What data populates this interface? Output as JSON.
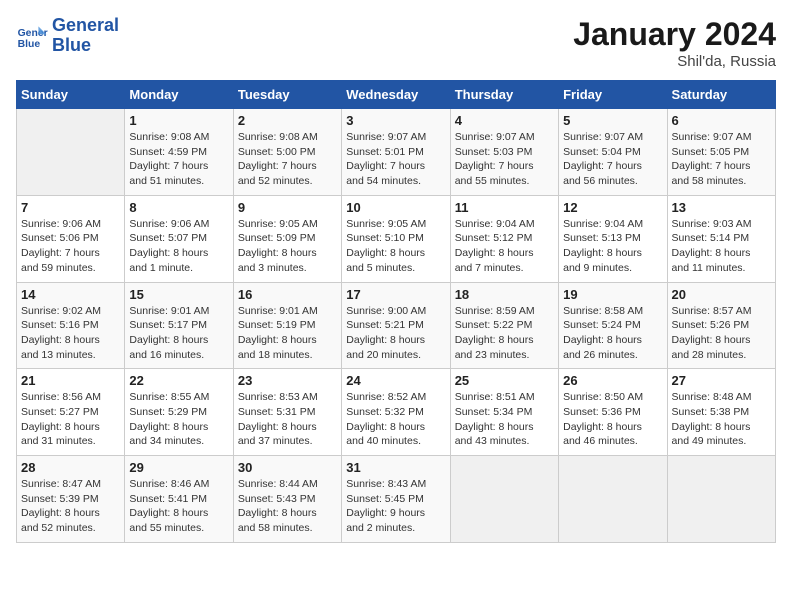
{
  "logo": {
    "line1": "General",
    "line2": "Blue"
  },
  "title": "January 2024",
  "subtitle": "Shil'da, Russia",
  "headers": [
    "Sunday",
    "Monday",
    "Tuesday",
    "Wednesday",
    "Thursday",
    "Friday",
    "Saturday"
  ],
  "weeks": [
    [
      {
        "day": "",
        "info": ""
      },
      {
        "day": "1",
        "info": "Sunrise: 9:08 AM\nSunset: 4:59 PM\nDaylight: 7 hours\nand 51 minutes."
      },
      {
        "day": "2",
        "info": "Sunrise: 9:08 AM\nSunset: 5:00 PM\nDaylight: 7 hours\nand 52 minutes."
      },
      {
        "day": "3",
        "info": "Sunrise: 9:07 AM\nSunset: 5:01 PM\nDaylight: 7 hours\nand 54 minutes."
      },
      {
        "day": "4",
        "info": "Sunrise: 9:07 AM\nSunset: 5:03 PM\nDaylight: 7 hours\nand 55 minutes."
      },
      {
        "day": "5",
        "info": "Sunrise: 9:07 AM\nSunset: 5:04 PM\nDaylight: 7 hours\nand 56 minutes."
      },
      {
        "day": "6",
        "info": "Sunrise: 9:07 AM\nSunset: 5:05 PM\nDaylight: 7 hours\nand 58 minutes."
      }
    ],
    [
      {
        "day": "7",
        "info": "Sunrise: 9:06 AM\nSunset: 5:06 PM\nDaylight: 7 hours\nand 59 minutes."
      },
      {
        "day": "8",
        "info": "Sunrise: 9:06 AM\nSunset: 5:07 PM\nDaylight: 8 hours\nand 1 minute."
      },
      {
        "day": "9",
        "info": "Sunrise: 9:05 AM\nSunset: 5:09 PM\nDaylight: 8 hours\nand 3 minutes."
      },
      {
        "day": "10",
        "info": "Sunrise: 9:05 AM\nSunset: 5:10 PM\nDaylight: 8 hours\nand 5 minutes."
      },
      {
        "day": "11",
        "info": "Sunrise: 9:04 AM\nSunset: 5:12 PM\nDaylight: 8 hours\nand 7 minutes."
      },
      {
        "day": "12",
        "info": "Sunrise: 9:04 AM\nSunset: 5:13 PM\nDaylight: 8 hours\nand 9 minutes."
      },
      {
        "day": "13",
        "info": "Sunrise: 9:03 AM\nSunset: 5:14 PM\nDaylight: 8 hours\nand 11 minutes."
      }
    ],
    [
      {
        "day": "14",
        "info": "Sunrise: 9:02 AM\nSunset: 5:16 PM\nDaylight: 8 hours\nand 13 minutes."
      },
      {
        "day": "15",
        "info": "Sunrise: 9:01 AM\nSunset: 5:17 PM\nDaylight: 8 hours\nand 16 minutes."
      },
      {
        "day": "16",
        "info": "Sunrise: 9:01 AM\nSunset: 5:19 PM\nDaylight: 8 hours\nand 18 minutes."
      },
      {
        "day": "17",
        "info": "Sunrise: 9:00 AM\nSunset: 5:21 PM\nDaylight: 8 hours\nand 20 minutes."
      },
      {
        "day": "18",
        "info": "Sunrise: 8:59 AM\nSunset: 5:22 PM\nDaylight: 8 hours\nand 23 minutes."
      },
      {
        "day": "19",
        "info": "Sunrise: 8:58 AM\nSunset: 5:24 PM\nDaylight: 8 hours\nand 26 minutes."
      },
      {
        "day": "20",
        "info": "Sunrise: 8:57 AM\nSunset: 5:26 PM\nDaylight: 8 hours\nand 28 minutes."
      }
    ],
    [
      {
        "day": "21",
        "info": "Sunrise: 8:56 AM\nSunset: 5:27 PM\nDaylight: 8 hours\nand 31 minutes."
      },
      {
        "day": "22",
        "info": "Sunrise: 8:55 AM\nSunset: 5:29 PM\nDaylight: 8 hours\nand 34 minutes."
      },
      {
        "day": "23",
        "info": "Sunrise: 8:53 AM\nSunset: 5:31 PM\nDaylight: 8 hours\nand 37 minutes."
      },
      {
        "day": "24",
        "info": "Sunrise: 8:52 AM\nSunset: 5:32 PM\nDaylight: 8 hours\nand 40 minutes."
      },
      {
        "day": "25",
        "info": "Sunrise: 8:51 AM\nSunset: 5:34 PM\nDaylight: 8 hours\nand 43 minutes."
      },
      {
        "day": "26",
        "info": "Sunrise: 8:50 AM\nSunset: 5:36 PM\nDaylight: 8 hours\nand 46 minutes."
      },
      {
        "day": "27",
        "info": "Sunrise: 8:48 AM\nSunset: 5:38 PM\nDaylight: 8 hours\nand 49 minutes."
      }
    ],
    [
      {
        "day": "28",
        "info": "Sunrise: 8:47 AM\nSunset: 5:39 PM\nDaylight: 8 hours\nand 52 minutes."
      },
      {
        "day": "29",
        "info": "Sunrise: 8:46 AM\nSunset: 5:41 PM\nDaylight: 8 hours\nand 55 minutes."
      },
      {
        "day": "30",
        "info": "Sunrise: 8:44 AM\nSunset: 5:43 PM\nDaylight: 8 hours\nand 58 minutes."
      },
      {
        "day": "31",
        "info": "Sunrise: 8:43 AM\nSunset: 5:45 PM\nDaylight: 9 hours\nand 2 minutes."
      },
      {
        "day": "",
        "info": ""
      },
      {
        "day": "",
        "info": ""
      },
      {
        "day": "",
        "info": ""
      }
    ]
  ]
}
